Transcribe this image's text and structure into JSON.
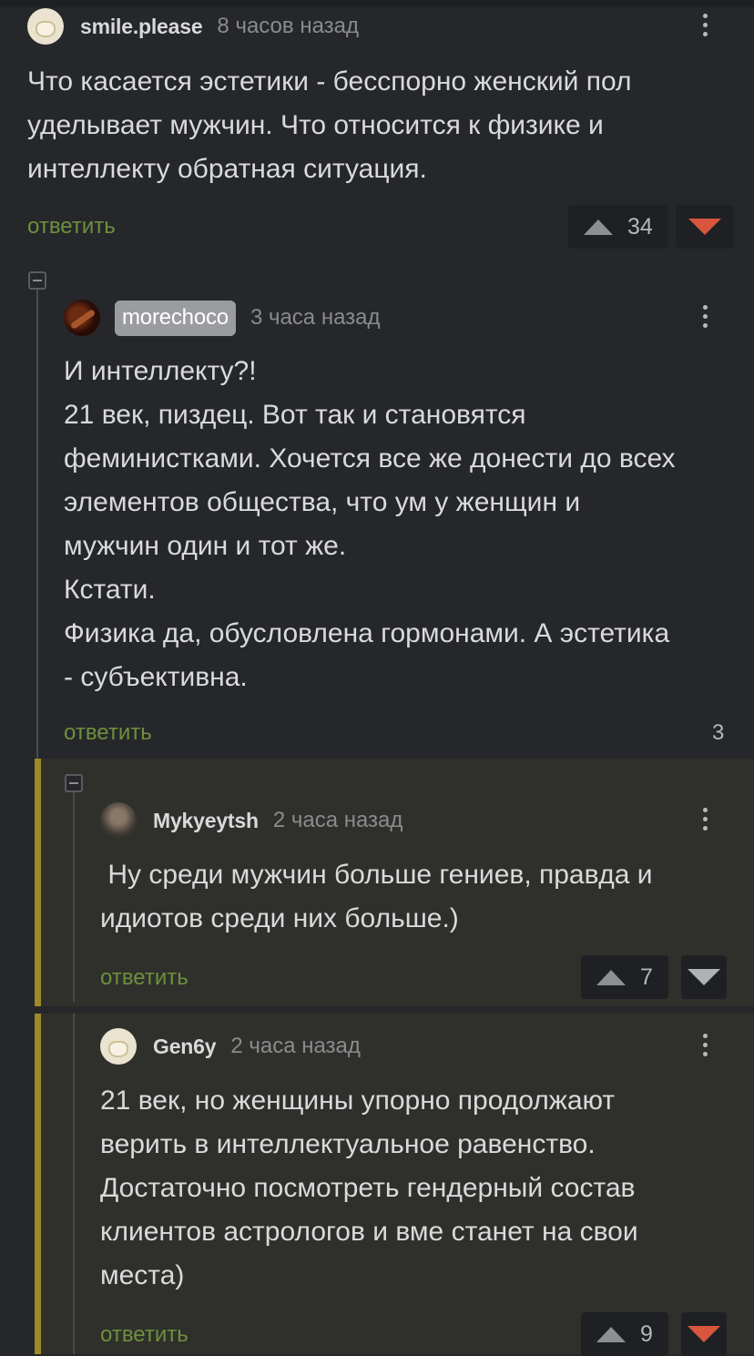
{
  "comments": [
    {
      "username": "smile.please",
      "time": "8 часов назад",
      "text": "Что касается эстетики - бесспорно женский пол\nуделывает мужчин. Что относится к физике и\nинтеллекту обратная ситуация.",
      "reply_label": "ответить",
      "votes": "34",
      "avatar_icon": "egg-avatar-icon"
    },
    {
      "username": "morechoco",
      "time": "3 часа назад",
      "text": "И интеллекту?!\n21 век, пиздец. Вот так и становятся\nфеминистками. Хочется все же донести до всех\nэлементов общества, что ум у женщин и\nмужчин один и тот же.\nКстати.\nФизика да, обусловлена гормонами. А эстетика\n- субъективна.",
      "reply_label": "ответить",
      "replies_count": "3",
      "avatar_icon": "chocolate-avatar-icon"
    },
    {
      "username": "Mykyeytsh",
      "time": "2 часа назад",
      "text": " Ну среди мужчин больше гениев, правда и\nидиотов среди них больше.)",
      "reply_label": "ответить",
      "votes": "7",
      "avatar_icon": "photo-avatar-icon"
    },
    {
      "username": "Gen6y",
      "time": "2 часа назад",
      "text": "21 век, но женщины упорно продолжают\nверить в интеллектуальное равенство.\nДостаточно посмотреть гендерный состав\nклиентов астрологов и вме станет на свои\nместа)",
      "reply_label": "ответить",
      "votes": "9",
      "avatar_icon": "egg-avatar-icon"
    }
  ],
  "colors": {
    "background": "#26272b",
    "reply_link": "#6e8f3e",
    "downvote_active": "#d8553e",
    "highlight_bar": "#9d8a2a",
    "highlight_bg": "#2f302b"
  }
}
